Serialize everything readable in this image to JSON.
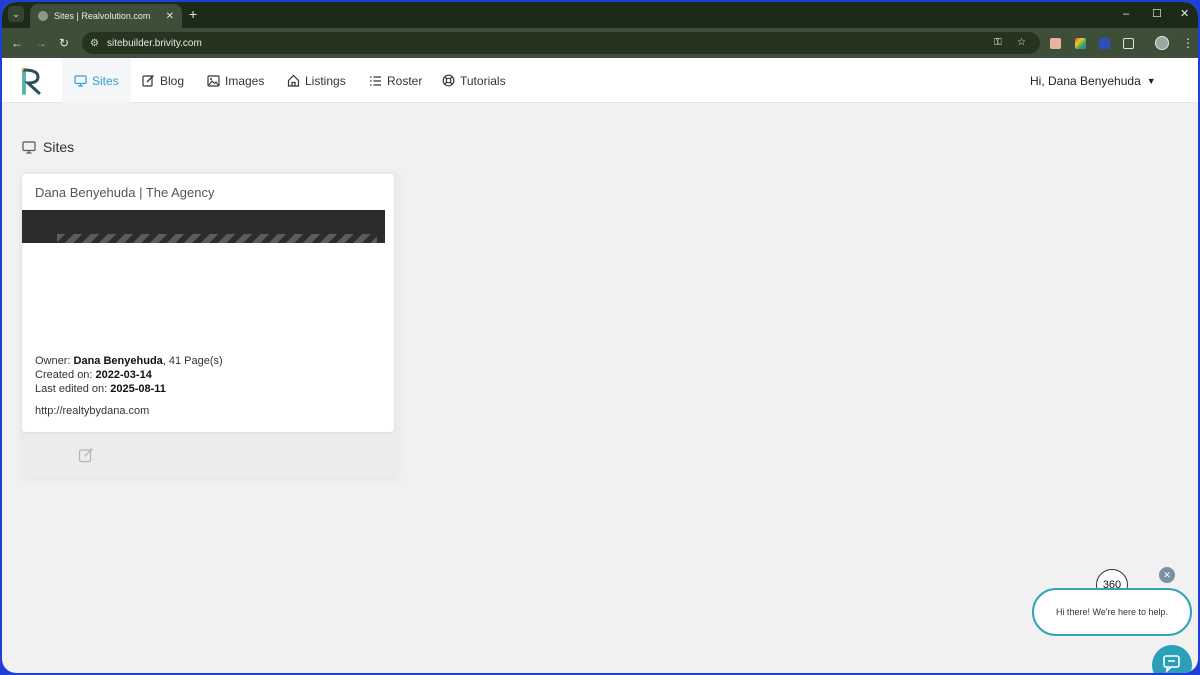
{
  "browser": {
    "tab_title": "Sites | Realvolution.com",
    "url": "sitebuilder.brivity.com",
    "tab_dropdown_icon": "chevron-down-icon",
    "new_tab_icon": "plus-icon",
    "close_tab_icon": "close-icon"
  },
  "nav": {
    "items": [
      {
        "label": "Sites",
        "icon": "monitor-icon",
        "active": true
      },
      {
        "label": "Blog",
        "icon": "edit-icon",
        "active": false
      },
      {
        "label": "Images",
        "icon": "image-icon",
        "active": false
      },
      {
        "label": "Listings",
        "icon": "home-icon",
        "active": false
      },
      {
        "label": "Roster",
        "icon": "list-icon",
        "active": false
      },
      {
        "label": "Tutorials",
        "icon": "lifebuoy-icon",
        "active": false
      }
    ],
    "user_greeting": "Hi, Dana Benyehuda"
  },
  "page": {
    "section_title": "Sites"
  },
  "site_card": {
    "title": "Dana Benyehuda | The Agency",
    "owner_label": "Owner:",
    "owner_name": "Dana Benyehuda",
    "pages": ", 41 Page(s)",
    "created_label": "Created on:",
    "created_value": "2022-03-14",
    "edited_label": "Last edited on:",
    "edited_value": "2025-08-11",
    "site_url": "http://realtybydana.com",
    "edit_icon": "edit-icon"
  },
  "chat": {
    "logo_text": "360",
    "message": "Hi there! We're here to help.",
    "close_icon": "close-icon",
    "launcher_icon": "chat-icon"
  },
  "colors": {
    "accent": "#2aa3d6",
    "chat_accent": "#2a9fb7",
    "browser_frame": "#3d4f38"
  }
}
